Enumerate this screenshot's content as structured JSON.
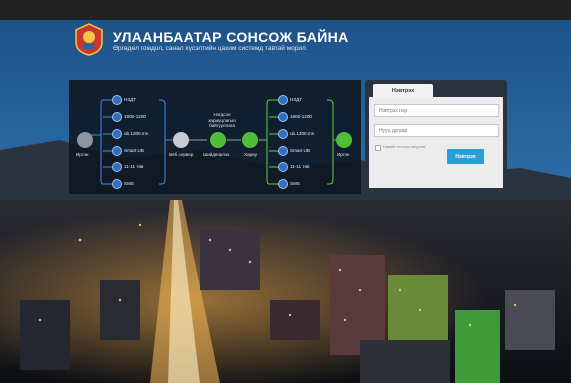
{
  "header": {
    "title": "УЛААНБААТАР СОНСОЖ БАЙНА",
    "subtitle": "Өргөдөл гомдол, санал хүсэлтийн цахим системд тавтай морил."
  },
  "diagram": {
    "left_actor": "Иргэн",
    "right_actor": "Иргэн",
    "left_channels": [
      "НЗДТ",
      "1800-1200",
      "ub.1200.mn",
      "Smart UB",
      "11-11 төв",
      "SMS"
    ],
    "right_channels": [
      "НЗДТ",
      "1800-1200",
      "ub.1200.mn",
      "Smart UB",
      "11-11 төв",
      "SMS"
    ],
    "flow": [
      {
        "label": "Веб сервер",
        "icon": "server-icon"
      },
      {
        "label": "Шийдвэрлэх",
        "icon": "check-icon"
      },
      {
        "label": "Хариу",
        "icon": "reply-icon"
      }
    ],
    "center_note": "Нэгдсэн хариуцлагын байгууллага"
  },
  "login": {
    "tab_label": "Нэвтрэх",
    "username_placeholder": "Нэвтрэх нэр",
    "password_placeholder": "Нууц дугаар",
    "remember_label": "Намайг тогтоож сануулах",
    "submit_label": "Нэвтрэх"
  },
  "colors": {
    "accent": "#2a9fd6",
    "left_line": "#3f8de0",
    "right_line": "#5fd23a",
    "node": "#2f6fbf",
    "actor": "#4fbf3a"
  }
}
